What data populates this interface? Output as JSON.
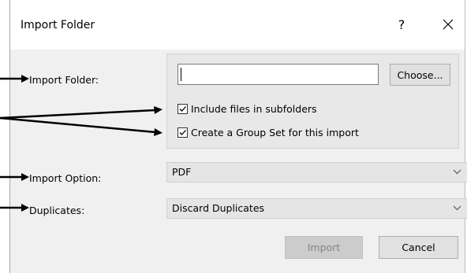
{
  "dialog": {
    "title": "Import Folder",
    "help_glyph": "?",
    "close_icon": "close-icon"
  },
  "labels": {
    "import_folder": "Import Folder:",
    "import_option": "Import Option:",
    "duplicates": "Duplicates:"
  },
  "folder": {
    "value": "",
    "choose_label": "Choose..."
  },
  "options": {
    "include_subfolders": {
      "label": "Include files in subfolders",
      "checked": true
    },
    "create_group_set": {
      "label": "Create a Group Set for this import",
      "checked": true
    }
  },
  "import_option": {
    "selected": "PDF"
  },
  "duplicates": {
    "selected": "Discard Duplicates"
  },
  "buttons": {
    "import": {
      "label": "Import",
      "enabled": false
    },
    "cancel": {
      "label": "Cancel"
    }
  },
  "colors": {
    "window_bg": "#f0f0f0",
    "titlebar_bg": "#ffffff",
    "group_bg": "#e8e8e8",
    "disabled_text": "#838383",
    "annotation_arrow": "#000000"
  }
}
